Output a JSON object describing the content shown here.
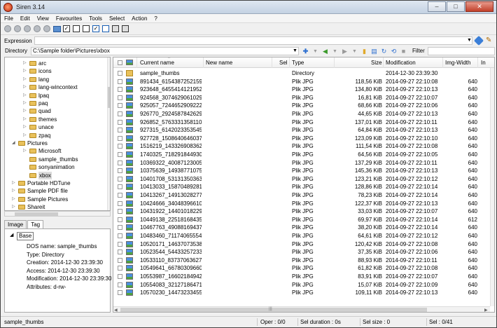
{
  "window": {
    "title": "Siren 3.14",
    "minimize": "–",
    "maximize": "□",
    "close": "✕"
  },
  "menu": [
    "File",
    "Edit",
    "View",
    "Favourites",
    "Tools",
    "Select",
    "Action",
    "?"
  ],
  "toolbar": {
    "check_glyph": "✓"
  },
  "expression": {
    "label": "Expression",
    "value": ""
  },
  "directory": {
    "label": "Directory",
    "value": "C:\\Sample folder\\Pictures\\xbox"
  },
  "filter": {
    "label": "Filter",
    "value": ""
  },
  "tree": [
    {
      "label": "arc",
      "level": 2,
      "expandable": true
    },
    {
      "label": "icons",
      "level": 2,
      "expandable": true
    },
    {
      "label": "lang",
      "level": 2,
      "expandable": true
    },
    {
      "label": "lang-wincontext",
      "level": 2,
      "expandable": true
    },
    {
      "label": "lpaq",
      "level": 2,
      "expandable": true
    },
    {
      "label": "paq",
      "level": 2,
      "expandable": true
    },
    {
      "label": "quad",
      "level": 2,
      "expandable": true
    },
    {
      "label": "themes",
      "level": 2,
      "expandable": true
    },
    {
      "label": "unace",
      "level": 2,
      "expandable": true
    },
    {
      "label": "zpaq",
      "level": 2,
      "expandable": true
    },
    {
      "label": "Pictures",
      "level": 1,
      "expanded": true
    },
    {
      "label": "Microsoft",
      "level": 2,
      "expandable": true
    },
    {
      "label": "sample_thumbs",
      "level": 2,
      "expandable": false
    },
    {
      "label": "sonyanimation",
      "level": 2,
      "expandable": false
    },
    {
      "label": "xbox",
      "level": 2,
      "expandable": false,
      "selected": true
    },
    {
      "label": "Portable HDTune",
      "level": 1,
      "expandable": true
    },
    {
      "label": "Sample PDF file",
      "level": 1,
      "expandable": true
    },
    {
      "label": "Sample Pictures",
      "level": 1,
      "expandable": true
    },
    {
      "label": "Shareit",
      "level": 1,
      "expandable": true
    }
  ],
  "tabs": [
    {
      "label": "Image",
      "active": false
    },
    {
      "label": "Tag",
      "active": true
    }
  ],
  "info": {
    "root": "Base",
    "lines": [
      "DOS name: sample_thumbs",
      "Type: Directory",
      "Creation: 2014-12-30 23:39:30",
      "Access: 2014-12-30 23:39:30",
      "Modification: 2014-12-30 23:39:30",
      "Attributes: d-rw-"
    ]
  },
  "columns": [
    "Current name",
    "New name",
    "Sel",
    "Type",
    "Size",
    "Modification",
    "Img-Width",
    "In"
  ],
  "files": [
    {
      "name": "sample_thumbs",
      "type": "Directory",
      "size": "",
      "mod": "2014-12-30 23:39:30",
      "width": "",
      "dir": true
    },
    {
      "name": "891434_6154387252159...",
      "type": "Plik JPG",
      "size": "118,56 KiB",
      "mod": "2014-09-27 22:10:08",
      "width": "640"
    },
    {
      "name": "923648_64554141219528...",
      "type": "Plik JPG",
      "size": "134,80 KiB",
      "mod": "2014-09-27 22:10:13",
      "width": "640"
    },
    {
      "name": "924568_30746290610292...",
      "type": "Plik JPG",
      "size": "16,81 KiB",
      "mod": "2014-09-27 22:10:07",
      "width": "640"
    },
    {
      "name": "925057_72446529092224...",
      "type": "Plik JPG",
      "size": "68,66 KiB",
      "mod": "2014-09-27 22:10:06",
      "width": "640"
    },
    {
      "name": "926770_29245878426294...",
      "type": "Plik JPG",
      "size": "44,65 KiB",
      "mod": "2014-09-27 22:10:13",
      "width": "640"
    },
    {
      "name": "926852_57633313581108...",
      "type": "Plik JPG",
      "size": "137,01 KiB",
      "mod": "2014-09-27 22:10:11",
      "width": "640"
    },
    {
      "name": "927315_61420233535455...",
      "type": "Plik JPG",
      "size": "64,84 KiB",
      "mod": "2014-09-27 22:10:13",
      "width": "640"
    },
    {
      "name": "927728_15086406460372...",
      "type": "Plik JPG",
      "size": "123,09 KiB",
      "mod": "2014-09-27 22:10:10",
      "width": "640"
    },
    {
      "name": "1516219_1433269083628...",
      "type": "Plik JPG",
      "size": "111,54 KiB",
      "mod": "2014-09-27 22:10:08",
      "width": "640"
    },
    {
      "name": "1740325_7182918449305...",
      "type": "Plik JPG",
      "size": "64,56 KiB",
      "mod": "2014-09-27 22:10:05",
      "width": "640"
    },
    {
      "name": "10369322_400871230053...",
      "type": "Plik JPG",
      "size": "137,29 KiB",
      "mod": "2014-09-27 22:10:11",
      "width": "640"
    },
    {
      "name": "10375639_149387710751...",
      "type": "Plik JPG",
      "size": "145,36 KiB",
      "mod": "2014-09-27 22:10:13",
      "width": "640"
    },
    {
      "name": "10401708_531313503639...",
      "type": "Plik JPG",
      "size": "123,21 KiB",
      "mod": "2014-09-27 22:10:12",
      "width": "640"
    },
    {
      "name": "10413033_158704892818...",
      "type": "Plik JPG",
      "size": "128,86 KiB",
      "mod": "2014-09-27 22:10:14",
      "width": "640"
    },
    {
      "name": "10413267_149130282777...",
      "type": "Plik JPG",
      "size": "78,23 KiB",
      "mod": "2014-09-27 22:10:14",
      "width": "640"
    },
    {
      "name": "10424666_340483966103...",
      "type": "Plik JPG",
      "size": "122,37 KiB",
      "mod": "2014-09-27 22:10:13",
      "width": "640"
    },
    {
      "name": "10431922_144010182293...",
      "type": "Plik JPG",
      "size": "33,03 KiB",
      "mod": "2014-09-27 22:10:07",
      "width": "640"
    },
    {
      "name": "10449138_225181684358...",
      "type": "Plik JPG",
      "size": "69,97 KiB",
      "mod": "2014-09-27 22:10:14",
      "width": "612"
    },
    {
      "name": "10467763_490881694377...",
      "type": "Plik JPG",
      "size": "38,20 KiB",
      "mod": "2014-09-27 22:10:14",
      "width": "640"
    },
    {
      "name": "10483460_711740655548...",
      "type": "Plik JPG",
      "size": "64,61 KiB",
      "mod": "2014-09-27 22:10:12",
      "width": "640"
    },
    {
      "name": "10520171_146370735388...",
      "type": "Plik JPG",
      "size": "120,42 KiB",
      "mod": "2014-09-27 22:10:08",
      "width": "640"
    },
    {
      "name": "10523544_544332572339...",
      "type": "Plik JPG",
      "size": "37,35 KiB",
      "mod": "2014-09-27 22:10:06",
      "width": "640"
    },
    {
      "name": "10533110_837370636274...",
      "type": "Plik JPG",
      "size": "88,93 KiB",
      "mod": "2014-09-27 22:10:11",
      "width": "640"
    },
    {
      "name": "10549641_667803096608...",
      "type": "Plik JPG",
      "size": "61,82 KiB",
      "mod": "2014-09-27 22:10:08",
      "width": "640"
    },
    {
      "name": "10553987_166021849420...",
      "type": "Plik JPG",
      "size": "83,91 KiB",
      "mod": "2014-09-27 22:10:07",
      "width": "640"
    },
    {
      "name": "10554083_321271864716...",
      "type": "Plik JPG",
      "size": "15,07 KiB",
      "mod": "2014-09-27 22:10:09",
      "width": "640"
    },
    {
      "name": "10570230_144732334552...",
      "type": "Plik JPG",
      "size": "109,11 KiB",
      "mod": "2014-09-27 22:10:13",
      "width": "640"
    }
  ],
  "status": {
    "name": "sample_thumbs",
    "oper": "Oper : 0/0",
    "duration": "Sel duration : 0s",
    "size": "Sel size : 0",
    "sel": "Sel : 0/41"
  },
  "colors": {
    "accent": "#3b7fd8",
    "folder": "#e9c15b",
    "close": "#c23f2a"
  }
}
